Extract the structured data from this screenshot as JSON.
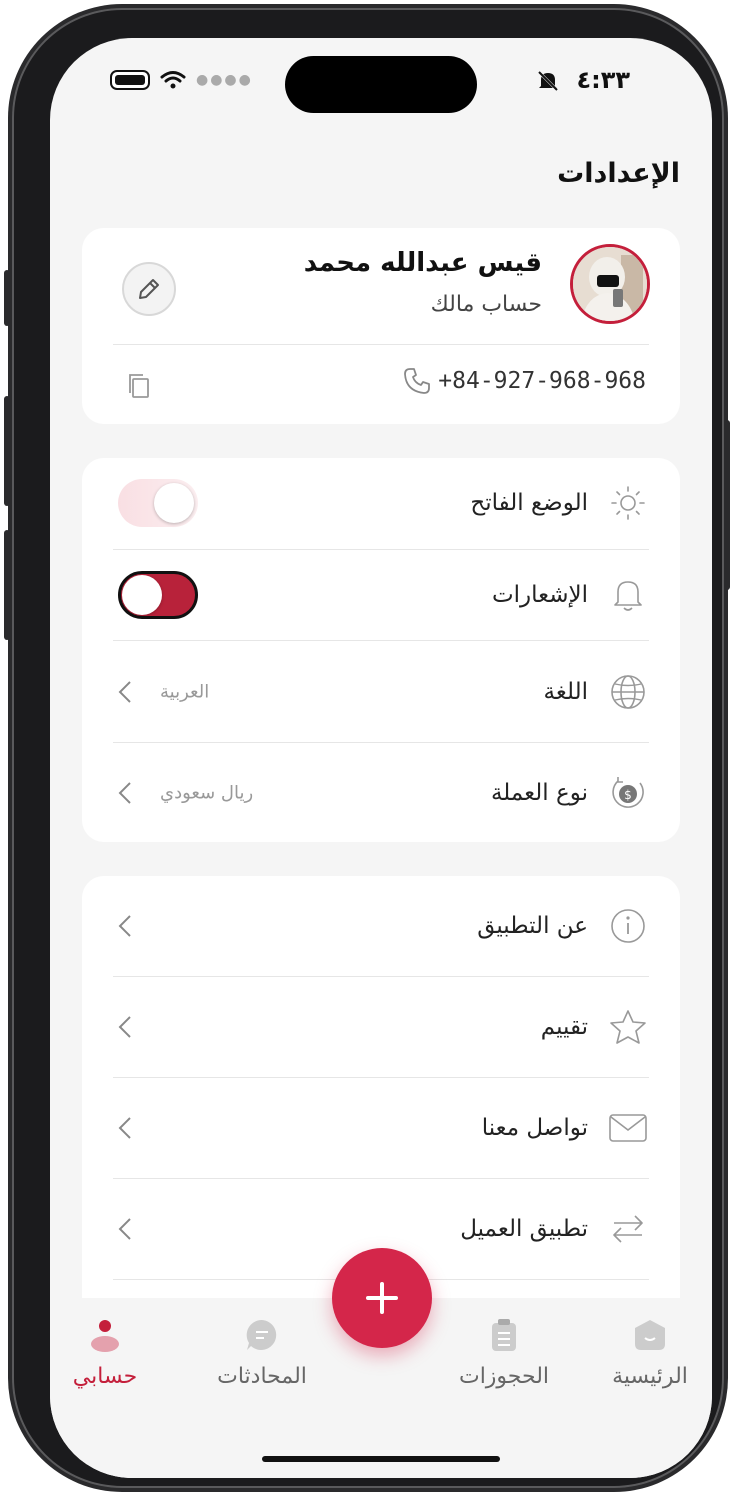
{
  "status": {
    "time": "٤:٣٣"
  },
  "page": {
    "title": "الإعدادات"
  },
  "profile": {
    "name": "قيس عبدالله محمد",
    "role": "حساب مالك",
    "phone": "+84-927-968-968"
  },
  "settings": {
    "light_mode": {
      "label": "الوضع الفاتح",
      "enabled": false
    },
    "notifications": {
      "label": "الإشعارات",
      "enabled": true
    },
    "language": {
      "label": "اللغة",
      "value": "العربية"
    },
    "currency": {
      "label": "نوع العملة",
      "value": "ريال سعودي"
    }
  },
  "more": {
    "about": "عن التطبيق",
    "rate": "تقييم",
    "contact": "تواصل معنا",
    "client_app": "تطبيق العميل"
  },
  "tabbar": {
    "home": "الرئيسية",
    "bookings": "الحجوزات",
    "chats": "المحادثات",
    "account": "حسابي",
    "active": "account"
  },
  "colors": {
    "accent": "#c41f3b",
    "fab": "#d4264a"
  }
}
